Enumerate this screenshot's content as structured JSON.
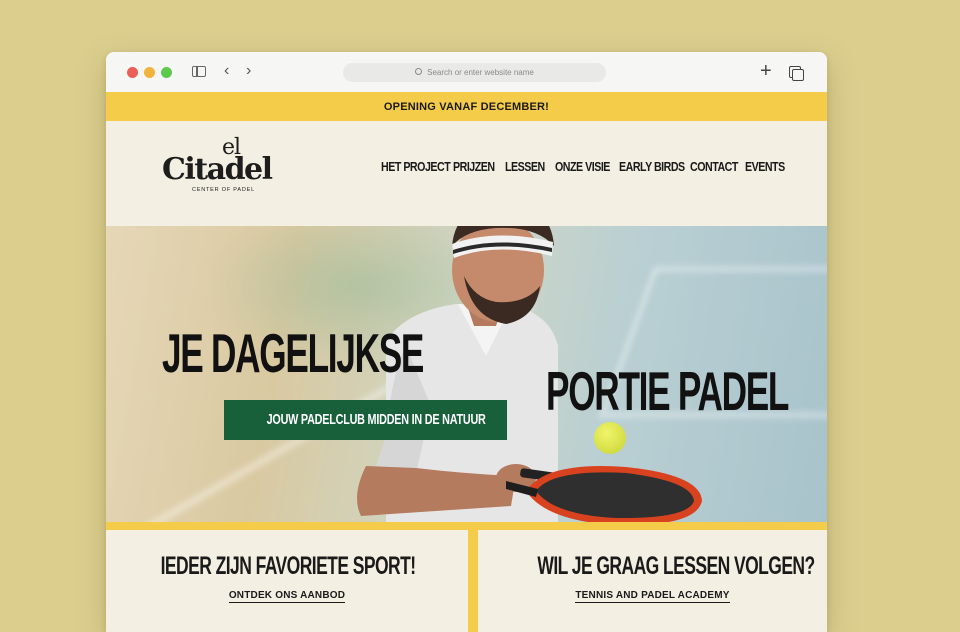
{
  "browser": {
    "url_placeholder": "Search or enter website name"
  },
  "announcement": "OPENING VANAF DECEMBER!",
  "logo": {
    "line1": "el",
    "line2": "Citadel",
    "tagline": "CENTER OF PADEL"
  },
  "nav": {
    "items": [
      {
        "label": "HET PROJECT"
      },
      {
        "label": "PRIJZEN"
      },
      {
        "label": "LESSEN"
      },
      {
        "label": "ONZE VISIE"
      },
      {
        "label": "EARLY BIRDS"
      },
      {
        "label": "CONTACT"
      },
      {
        "label": "EVENTS"
      }
    ]
  },
  "hero": {
    "title_line1": "JE DAGELIJKSE",
    "title_line2": "PORTIE PADEL",
    "cta_label": "JOUW PADELCLUB MIDDEN IN DE NATUUR"
  },
  "cards": [
    {
      "title": "IEDER ZIJN FAVORIETE SPORT!",
      "link": "ONTDEK ONS AANBOD"
    },
    {
      "title": "WIL JE GRAAG LESSEN VOLGEN?",
      "link": "TENNIS AND PADEL ACADEMY"
    }
  ],
  "colors": {
    "page_background": "#dccf8e",
    "accent_yellow": "#f5cc4a",
    "cta_green": "#17603a",
    "cream": "#f3efe2"
  }
}
